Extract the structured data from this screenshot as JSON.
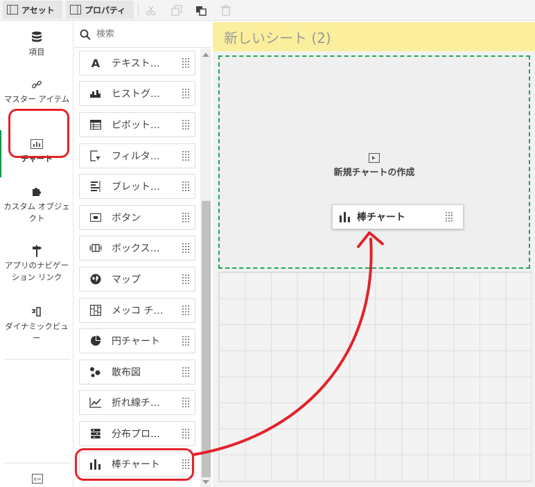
{
  "toolbar": {
    "assets_label": "アセット",
    "properties_label": "プロパティ"
  },
  "leftnav": {
    "items": [
      {
        "label": "項目",
        "icon": "database-icon"
      },
      {
        "label": "マスター アイテム",
        "icon": "link-icon"
      },
      {
        "label": "チャート",
        "icon": "bar-chart-icon"
      },
      {
        "label": "カスタム オブジェクト",
        "icon": "puzzle-icon"
      },
      {
        "label": "アプリのナビゲーション リンク",
        "icon": "signpost-icon"
      },
      {
        "label": "ダイナミックビュー",
        "icon": "dynamic-view-icon"
      }
    ]
  },
  "search": {
    "placeholder": "検索"
  },
  "chartlist": {
    "items": [
      {
        "label": "テキスト…",
        "icon": "text-icon"
      },
      {
        "label": "ヒストグ…",
        "icon": "histogram-icon"
      },
      {
        "label": "ピボット…",
        "icon": "pivot-table-icon"
      },
      {
        "label": "フィルタ…",
        "icon": "filter-pane-icon"
      },
      {
        "label": "ブレット…",
        "icon": "bullet-chart-icon"
      },
      {
        "label": "ボタン",
        "icon": "button-icon"
      },
      {
        "label": "ボックス…",
        "icon": "box-plot-icon"
      },
      {
        "label": "マップ",
        "icon": "globe-icon"
      },
      {
        "label": "メッコ チ…",
        "icon": "mekko-icon"
      },
      {
        "label": "円チャート",
        "icon": "pie-chart-icon"
      },
      {
        "label": "散布図",
        "icon": "scatter-icon"
      },
      {
        "label": "折れ線チ…",
        "icon": "line-chart-icon"
      },
      {
        "label": "分布プロ…",
        "icon": "distribution-plot-icon"
      },
      {
        "label": "棒チャート",
        "icon": "bar-chart-icon"
      }
    ]
  },
  "sheet": {
    "title": "新しいシート (2)",
    "create_label": "新規チャートの作成",
    "drag_card_label": "棒チャート"
  },
  "colors": {
    "highlight": "#e3222a",
    "accent": "#009845",
    "sheet_header": "#fbef9e"
  }
}
